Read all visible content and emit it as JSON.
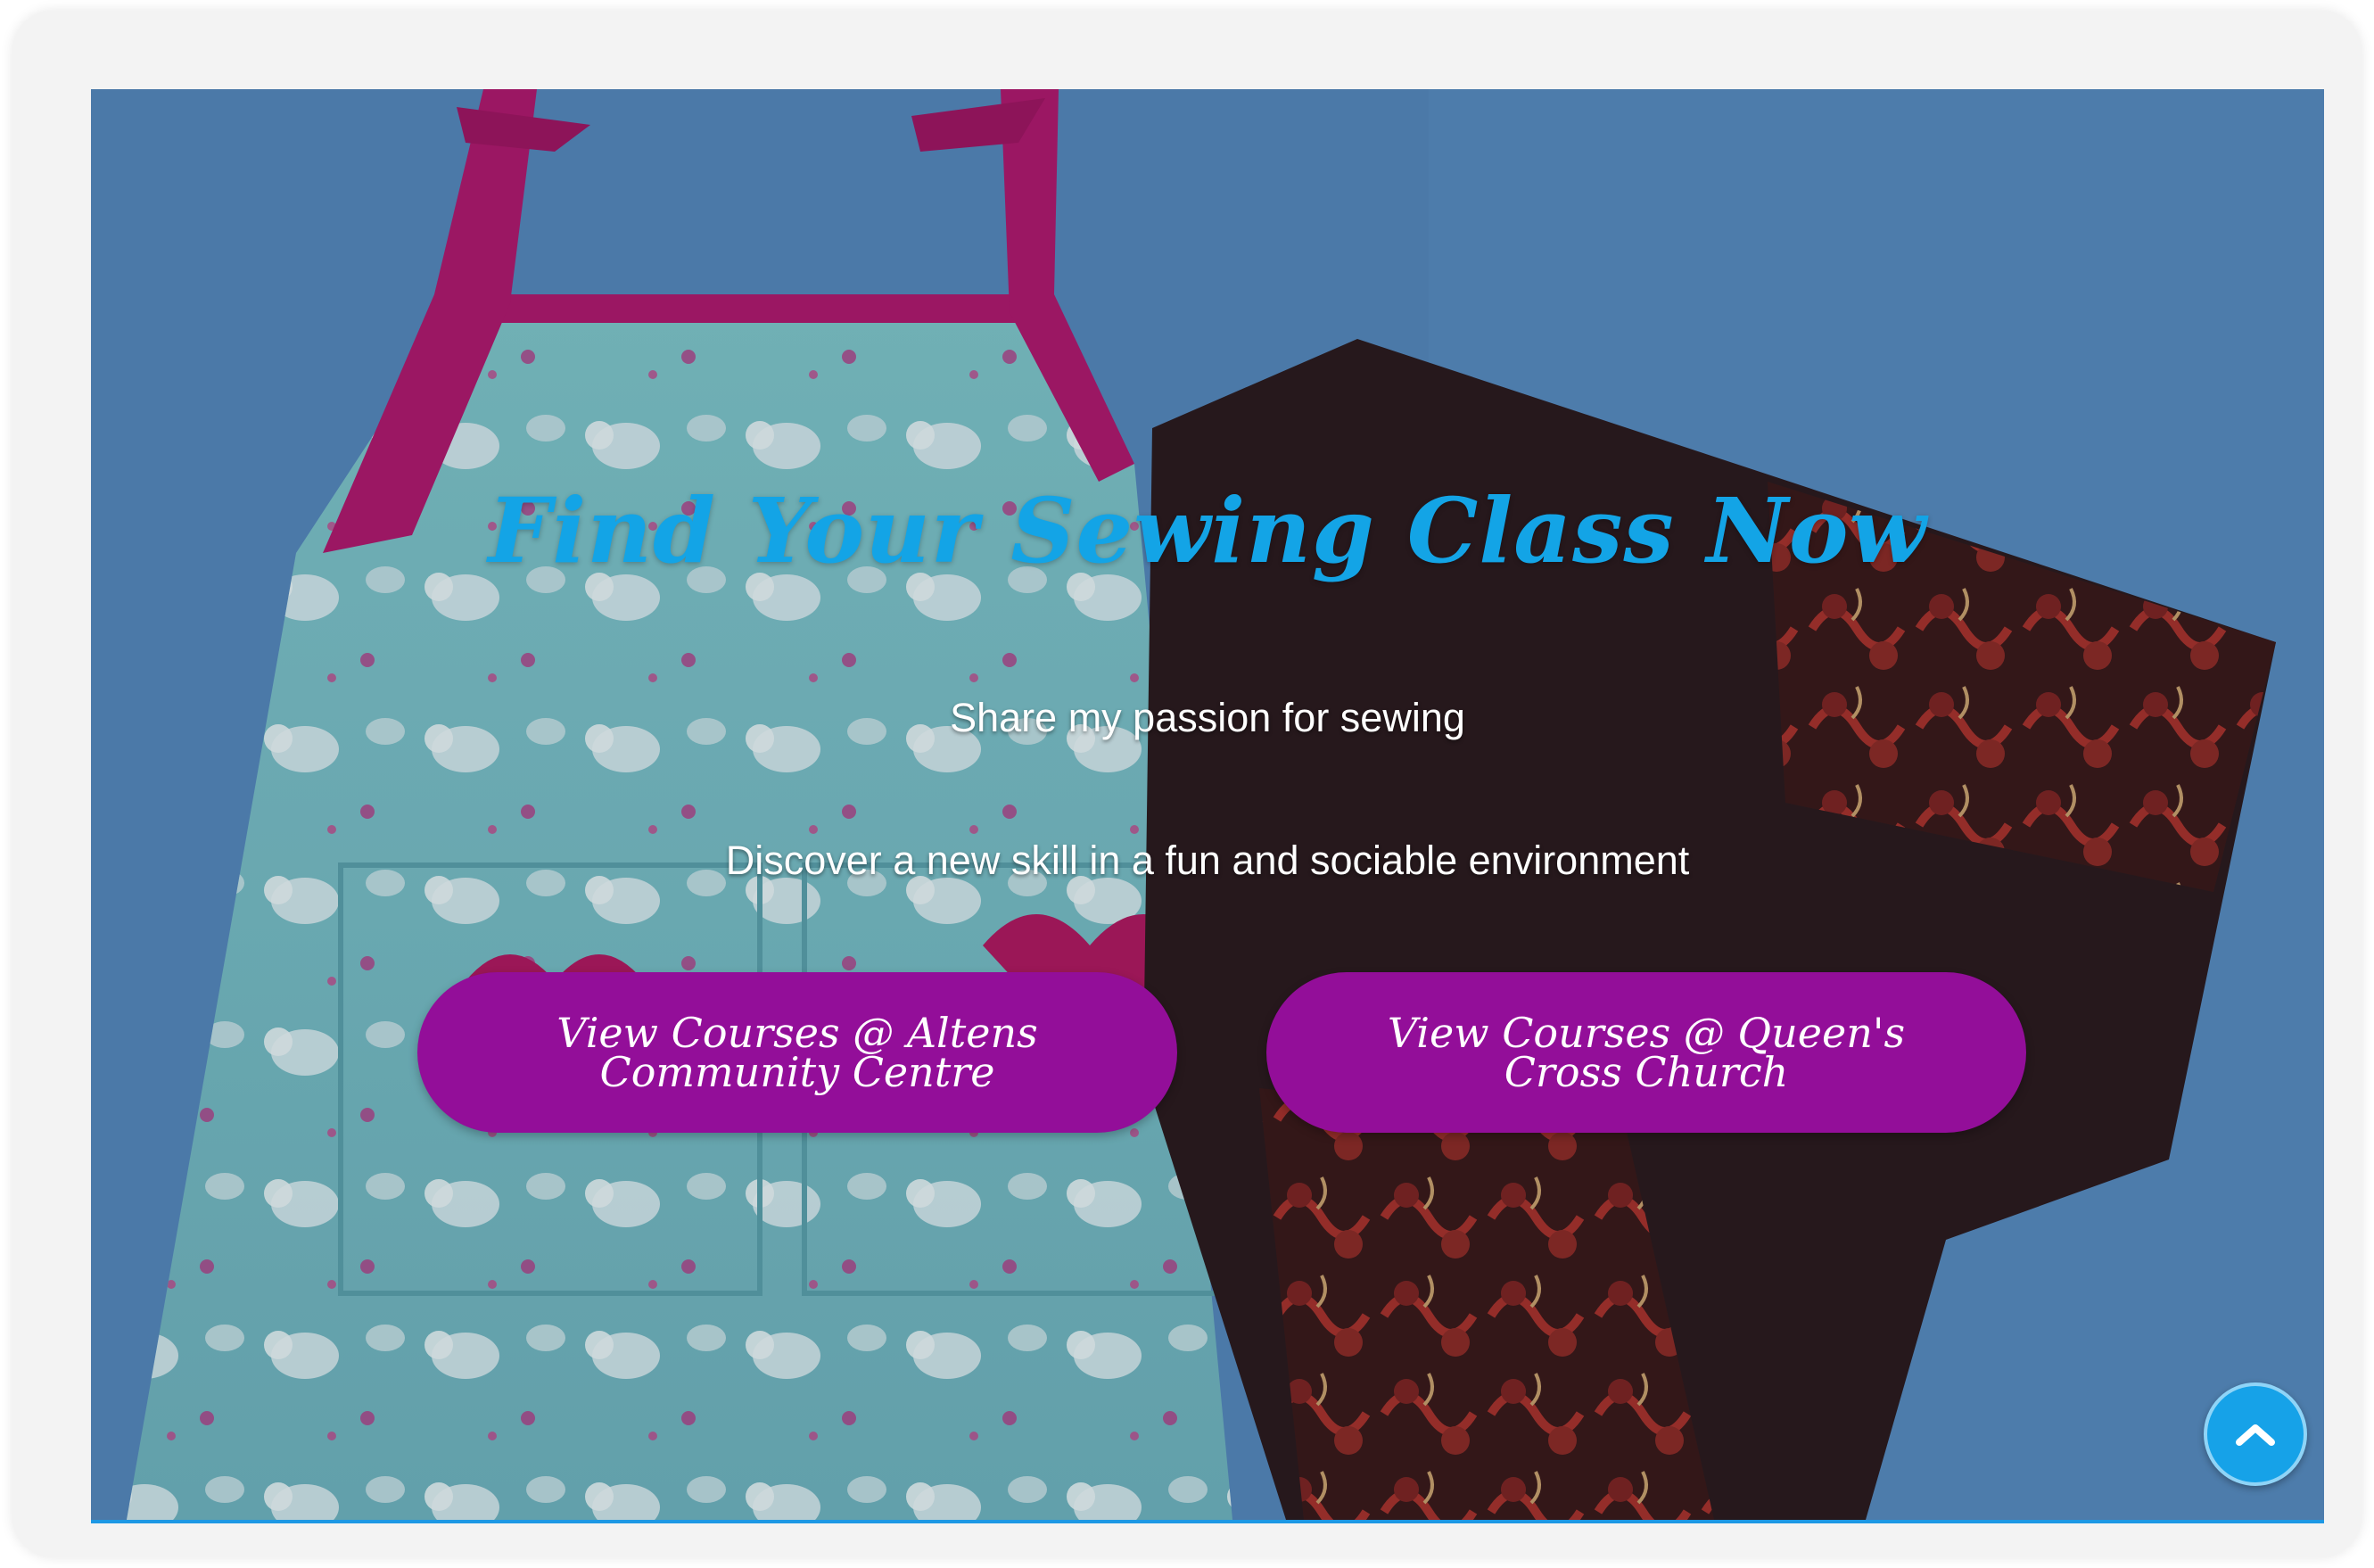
{
  "hero": {
    "title": "Find Your Sewing Class Now",
    "subtitle_1": "Share my passion for sewing",
    "subtitle_2": "Discover a new skill in a fun and sociable environment",
    "background_image": "sewing-projects-photo"
  },
  "buttons": {
    "altens": {
      "line1": "View Courses @ Altens",
      "line2": "Community Centre"
    },
    "queens_cross": {
      "line1": "View Courses @ Queen's",
      "line2": "Cross Church"
    }
  },
  "back_to_top": {
    "icon": "chevron-up-icon"
  },
  "colors": {
    "title": "#13a4e6",
    "button_bg": "#930e99",
    "button_text": "#ffffff",
    "back_to_top_bg": "#16a2e8",
    "background": "#4f7fb3",
    "accent_border": "#1d98e4"
  }
}
